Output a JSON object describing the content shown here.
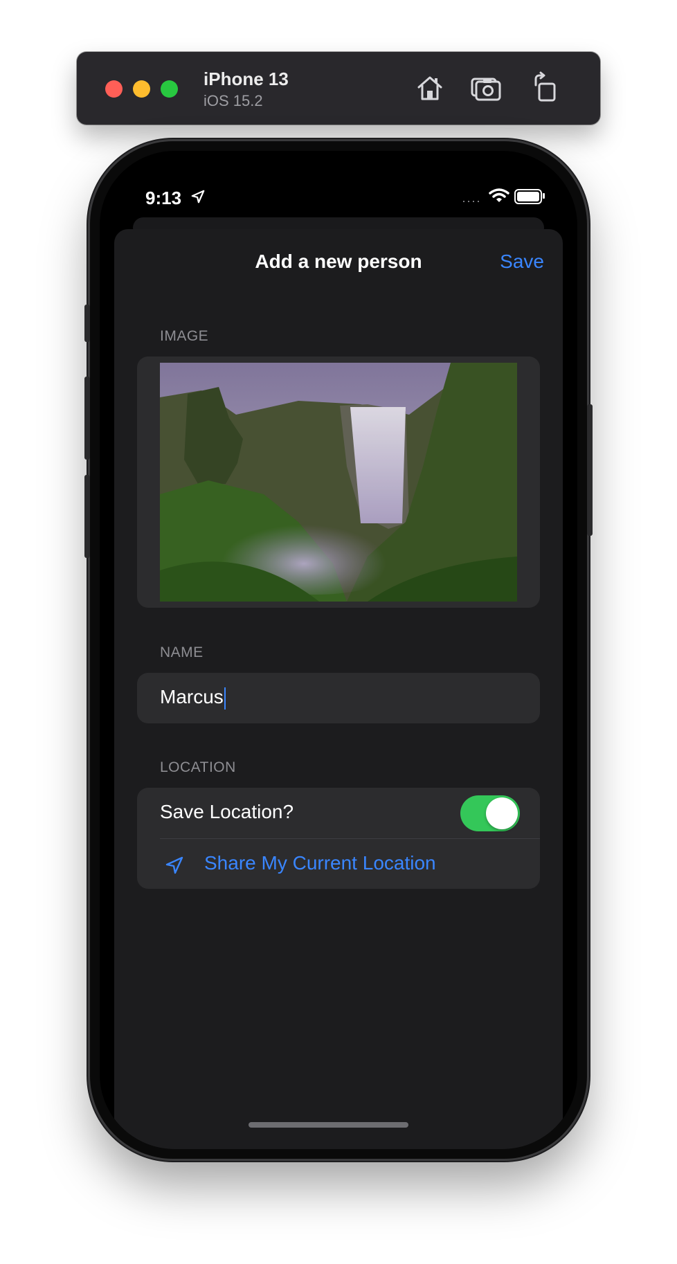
{
  "window": {
    "device": "iPhone 13",
    "os": "iOS 15.2"
  },
  "toolbar_icons": [
    "home-icon",
    "screenshot-icon",
    "rotate-icon"
  ],
  "status_bar": {
    "time": "9:13",
    "signal_dots": "····",
    "icons": [
      "location-arrow-icon",
      "wifi-icon",
      "battery-icon"
    ]
  },
  "nav": {
    "title": "Add a new person",
    "save_label": "Save"
  },
  "sections": {
    "image": {
      "header": "IMAGE"
    },
    "name": {
      "header": "NAME",
      "value": "Marcus"
    },
    "location": {
      "header": "LOCATION",
      "toggle_label": "Save Location?",
      "toggle_on": true,
      "share_label": "Share My Current Location"
    }
  },
  "colors": {
    "accent": "#3a86ff",
    "toggle_on": "#34c759",
    "background": "#1c1c1e",
    "group_bg": "#2c2c2e"
  }
}
